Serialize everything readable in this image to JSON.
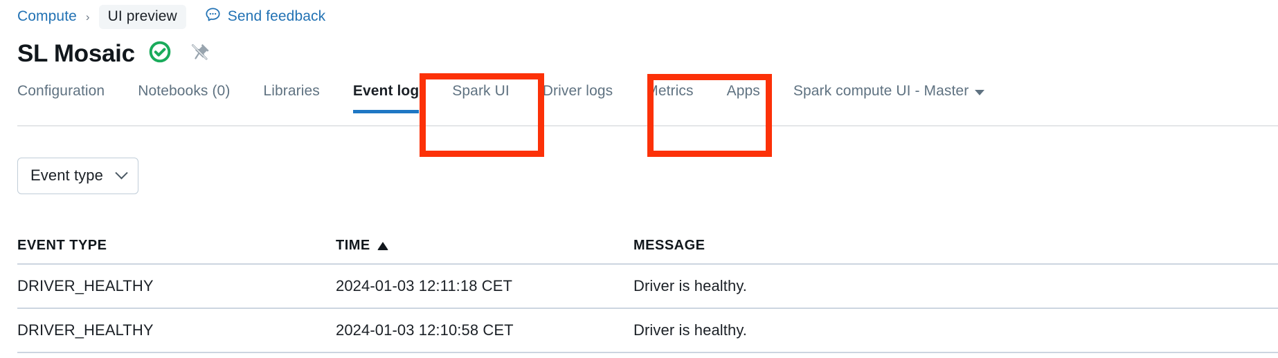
{
  "breadcrumb": {
    "parent_label": "Compute",
    "separator": "›",
    "current_label": "UI preview",
    "feedback_label": "Send feedback",
    "feedback_icon": "chat-bubble-icon"
  },
  "header": {
    "title": "SL Mosaic",
    "status_icon": "check-circle-icon",
    "status_color": "#1aab5b",
    "pin_icon": "pin-off-icon",
    "pin_color": "#98a4ae"
  },
  "tabs": {
    "items": [
      {
        "label": "Configuration",
        "active": false,
        "highlighted": false
      },
      {
        "label": "Notebooks (0)",
        "active": false,
        "highlighted": false
      },
      {
        "label": "Libraries",
        "active": false,
        "highlighted": false
      },
      {
        "label": "Event log",
        "active": true,
        "highlighted": true
      },
      {
        "label": "Spark UI",
        "active": false,
        "highlighted": false
      },
      {
        "label": "Driver logs",
        "active": false,
        "highlighted": true
      },
      {
        "label": "Metrics",
        "active": false,
        "highlighted": false
      },
      {
        "label": "Apps",
        "active": false,
        "highlighted": false
      }
    ],
    "dropdown_label": "Spark compute UI - Master",
    "dropdown_icon": "caret-down-icon",
    "active_indicator_color": "#1f77c4",
    "highlight_color": "#fc3108"
  },
  "filters": {
    "event_type_label": "Event type",
    "event_type_icon": "chevron-down-icon"
  },
  "table": {
    "columns": [
      {
        "key": "event_type",
        "label": "EVENT TYPE",
        "sorted": false
      },
      {
        "key": "time",
        "label": "TIME",
        "sorted": true,
        "sort_direction": "asc",
        "sort_icon": "caret-up-icon"
      },
      {
        "key": "message",
        "label": "MESSAGE",
        "sorted": false
      }
    ],
    "rows": [
      {
        "event_type": "DRIVER_HEALTHY",
        "time": "2024-01-03 12:11:18 CET",
        "message": "Driver is healthy."
      },
      {
        "event_type": "DRIVER_HEALTHY",
        "time": "2024-01-03 12:10:58 CET",
        "message": "Driver is healthy."
      }
    ]
  }
}
